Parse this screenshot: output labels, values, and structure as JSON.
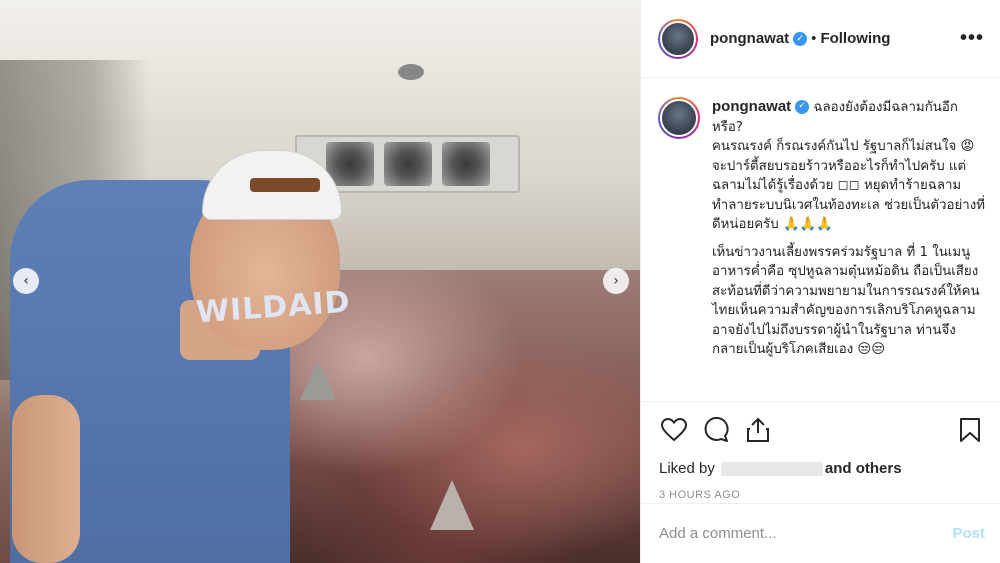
{
  "post": {
    "username": "pongnawat",
    "follow_status": "Following",
    "more_label": "•••"
  },
  "photo": {
    "shirt_text": "WILDAID",
    "prev_label": "‹",
    "next_label": "›"
  },
  "caption": {
    "username": "pongnawat",
    "paragraph1": "ฉลองยังต้องมีฉลามกันอีกหรือ?\nคนรณรงค์ ก็รณรงค์กันไป รัฐบาลก็ไม่สนใจ 😡 จะปาร์ตี้สยบรอยร้าวหรืออะไรก็ทำไปครับ แต่ฉลามไม่ได้รู้เรื่องด้วย ◻◻ หยุดทำร้ายฉลาม ทำลายระบบนิเวศในท้องทะเล ช่วยเป็นตัวอย่างที่ดีหน่อยครับ 🙏🙏🙏",
    "paragraph2": "เห็นข่าวงานเลี้ยงพรรคร่วมรัฐบาล ที่ 1 ในเมนูอาหารค่ำคือ ซุปหูฉลามตุ๋นหม้อดิน ถือเป็นเสียงสะท้อนที่ดีว่าความพยายามในการรณรงค์ให้คนไทยเห็นความสำคัญของการเลิกบริโภคหูฉลาม อาจยังไปไม่ถึงบรรดาผู้นำในรัฐบาล ท่านจึงกลายเป็นผู้บริโภคเสียเอง 😒😒"
  },
  "actions": {
    "icons": [
      "heart-icon",
      "comment-icon",
      "share-icon",
      "bookmark-icon"
    ],
    "liked_by_prefix": "Liked by",
    "and_others": "and others",
    "timestamp": "3 HOURS AGO"
  },
  "comment": {
    "placeholder": "Add a comment...",
    "post_label": "Post"
  },
  "colors": {
    "verified": "#3897f0",
    "post_disabled": "#b2dffc"
  }
}
